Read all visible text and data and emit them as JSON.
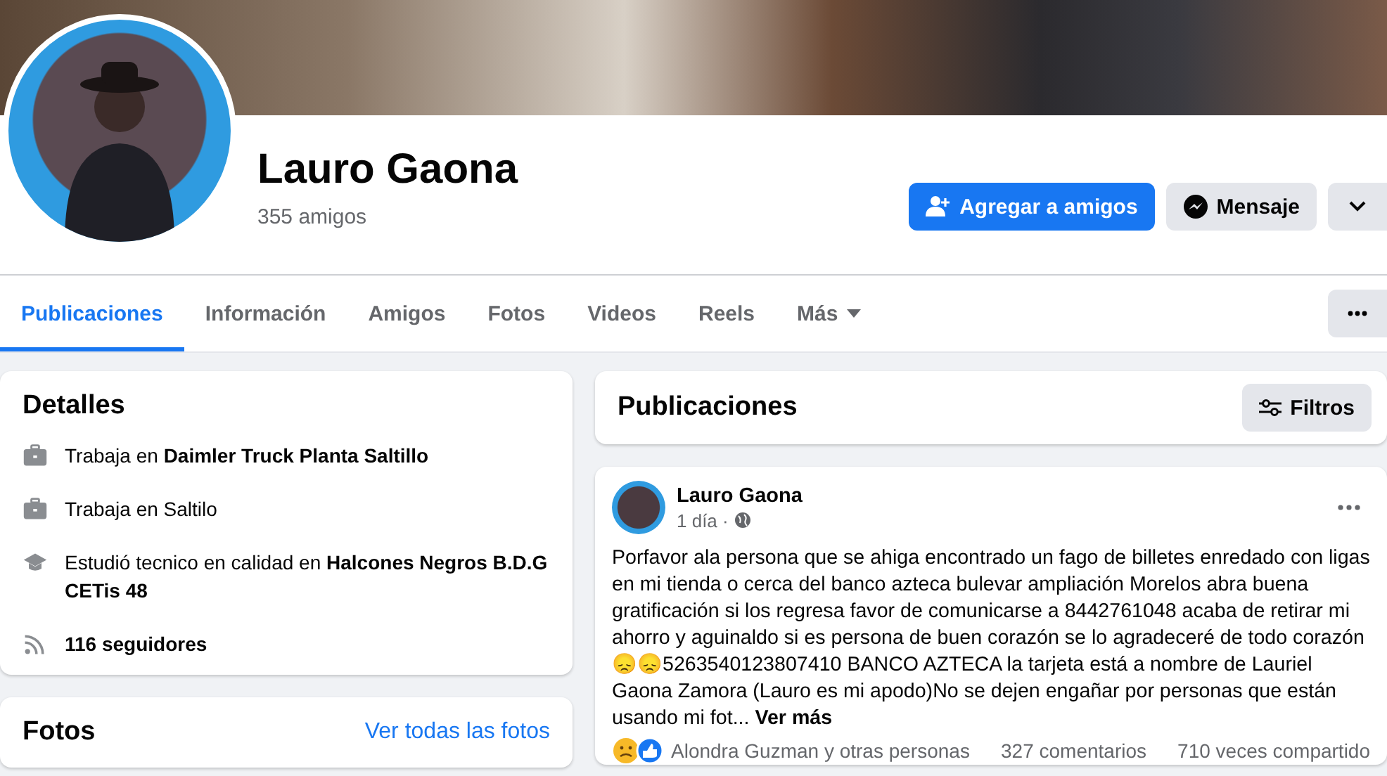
{
  "profile": {
    "name": "Lauro Gaona",
    "friends": "355 amigos"
  },
  "actions": [
    {
      "kind": "add",
      "label": "Agregar a amigos"
    },
    {
      "kind": "message",
      "label": "Mensaje"
    },
    {
      "kind": "dropdown"
    }
  ],
  "tabs": [
    {
      "label": "Publicaciones",
      "selected": true,
      "kind": "tab"
    },
    {
      "label": "Información",
      "selected": false,
      "kind": "tab"
    },
    {
      "label": "Amigos",
      "selected": false,
      "kind": "tab"
    },
    {
      "label": "Fotos",
      "selected": false,
      "kind": "tab"
    },
    {
      "label": "Videos",
      "selected": false,
      "kind": "tab"
    },
    {
      "label": "Reels",
      "selected": false,
      "kind": "tab"
    },
    {
      "label": "Más",
      "selected": false,
      "kind": "menu"
    }
  ],
  "details": {
    "title": "Detalles",
    "items": [
      {
        "kind": "work",
        "text": "Trabaja en **Daimler Truck Planta Saltillo**"
      },
      {
        "kind": "work",
        "text": "Trabaja en Saltilo"
      },
      {
        "kind": "education",
        "text": "Estudió tecnico en calidad en **Halcones Negros B.D.G CETis 48**"
      },
      {
        "kind": "followers",
        "text": "**116 seguidores**"
      }
    ]
  },
  "photos": {
    "title": "Fotos",
    "link": "Ver todas las fotos"
  },
  "posts_header": {
    "title": "Publicaciones",
    "filter": "Filtros"
  },
  "post": {
    "author": "Lauro Gaona",
    "time": "1 día ·",
    "text": "Porfavor ala persona que se ahiga encontrado un fago de billetes enredado con ligas en mi tienda o cerca del banco azteca bulevar ampliación Morelos abra buena gratificación si los regresa favor de comunicarse a 8442761048 acaba de retirar mi ahorro y aguinaldo si es persona de buen corazón se lo agradeceré de todo corazón 😞😞5263540123807410 BANCO AZTECA la tarjeta está a nombre de Lauriel Gaona Zamora (Lauro es mi apodo)No se dejen engañar por personas que están usando mi fot...",
    "see_more": "Ver más",
    "reactions": "Alondra Guzman y otras personas",
    "comments": "327 comentarios",
    "shares": "710 veces compartido"
  }
}
